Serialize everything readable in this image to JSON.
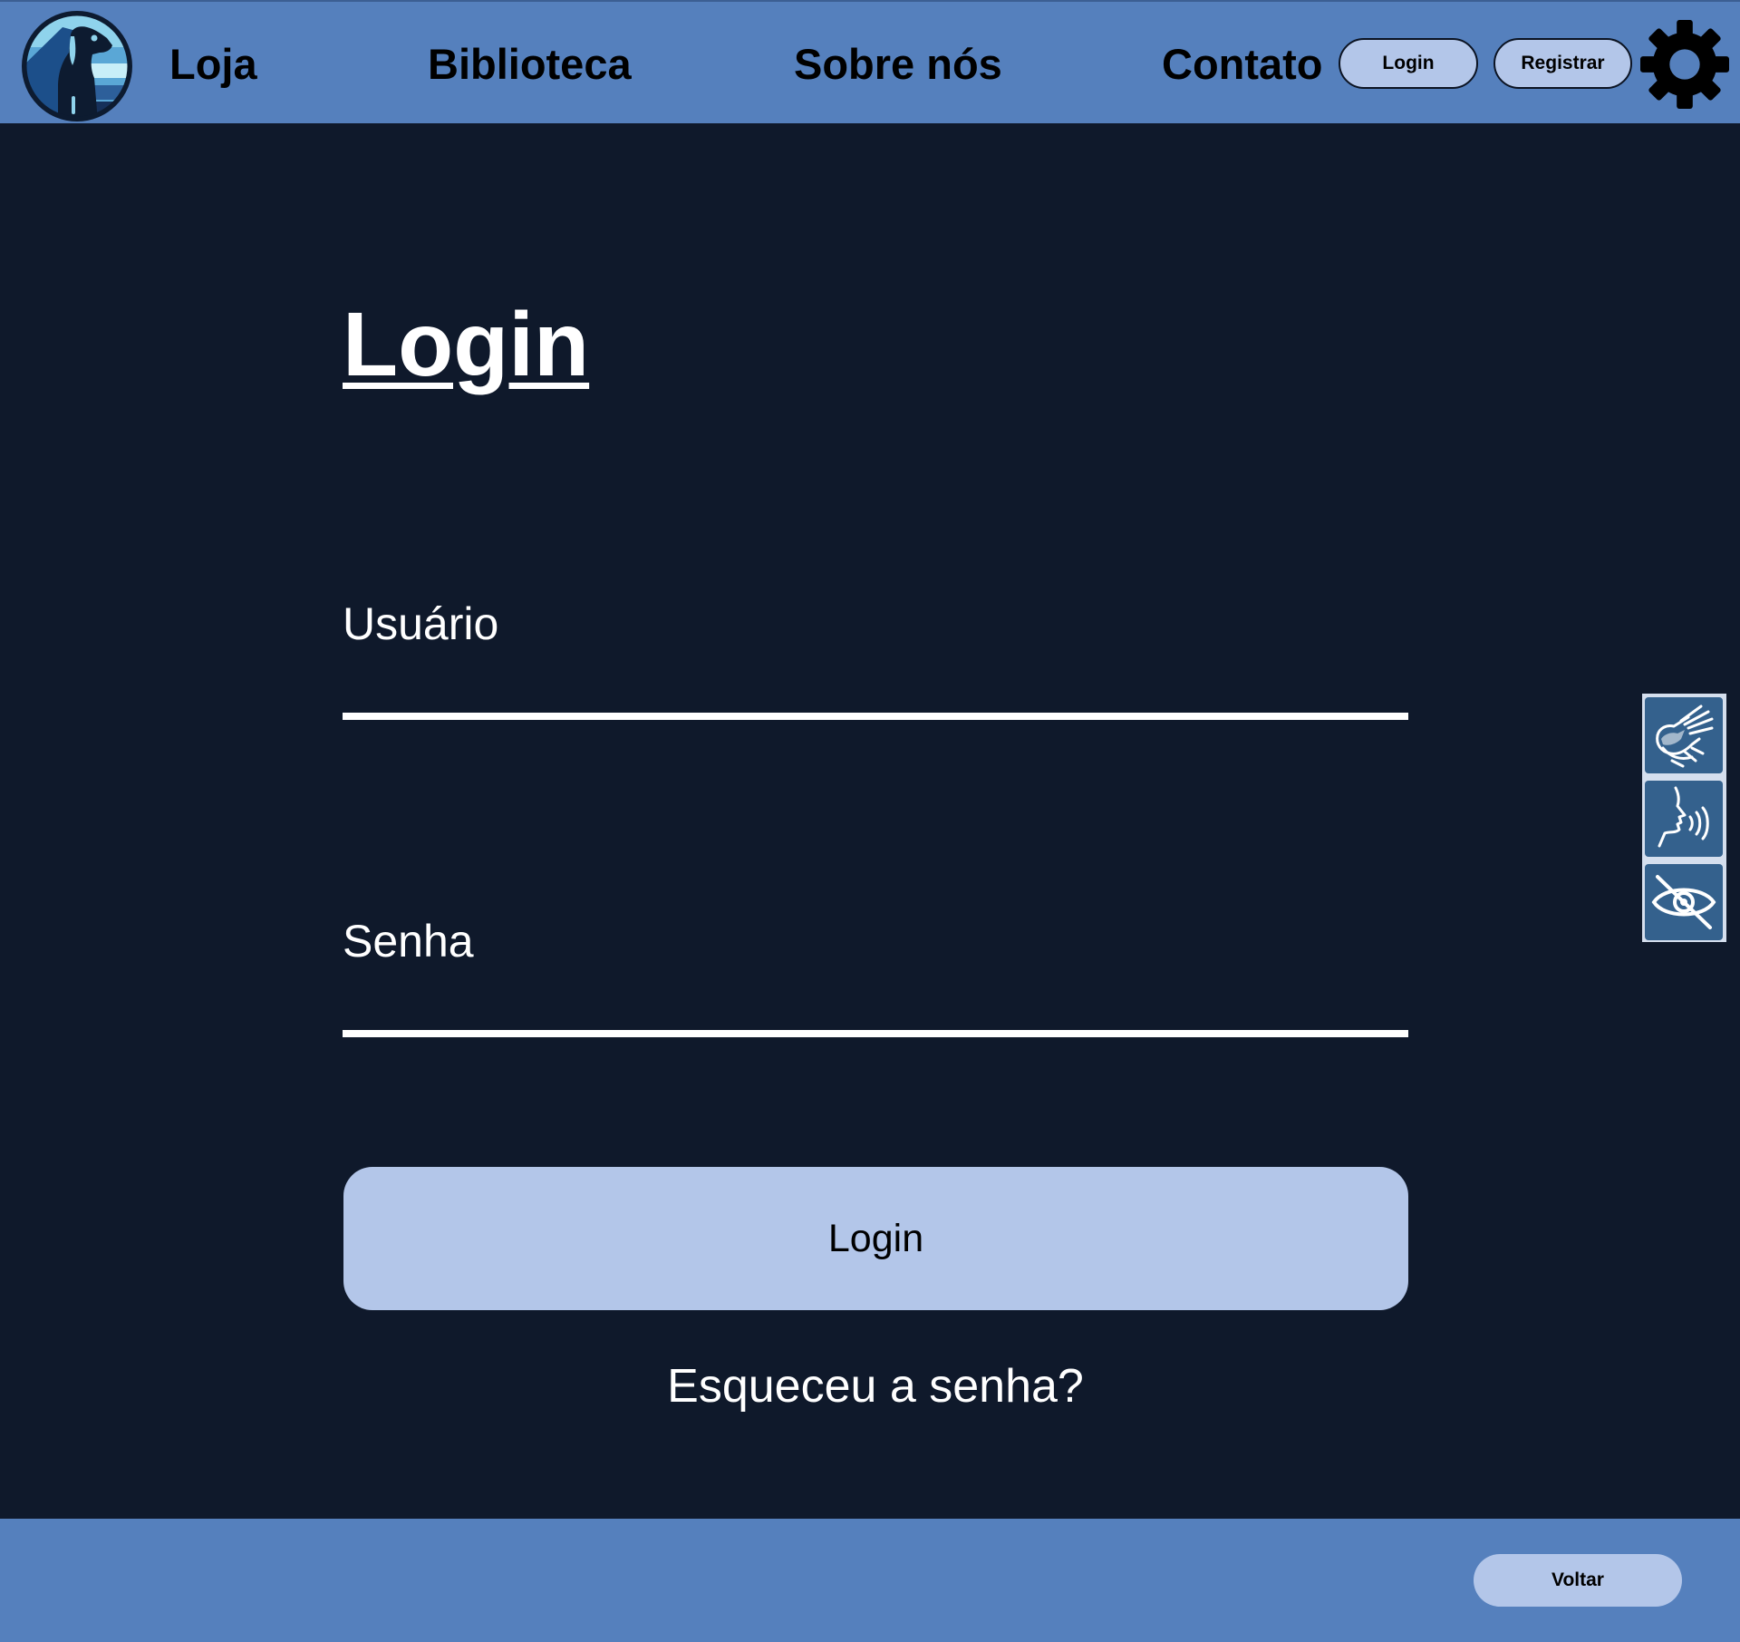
{
  "header": {
    "logo_name": "dog-logo",
    "nav": {
      "loja": "Loja",
      "biblioteca": "Biblioteca",
      "sobre": "Sobre nós",
      "contato": "Contato"
    },
    "login_button": "Login",
    "register_button": "Registrar",
    "settings_icon": "gear-icon"
  },
  "main": {
    "title": "Login",
    "usuario_label": "Usuário",
    "usuario_value": "",
    "senha_label": "Senha",
    "senha_value": "",
    "submit_label": "Login",
    "forgot_label": "Esqueceu a senha?"
  },
  "accessibility": {
    "items": [
      "sign-language-icon",
      "voice-reader-icon",
      "visual-impairment-icon"
    ]
  },
  "footer": {
    "back_label": "Voltar"
  },
  "colors": {
    "header_bg": "#5580bd",
    "page_bg": "#0f192b",
    "button_bg": "#b3c6e9",
    "a11y_button_bg": "#34618d",
    "text_light": "#ffffff",
    "text_dark": "#000000"
  }
}
